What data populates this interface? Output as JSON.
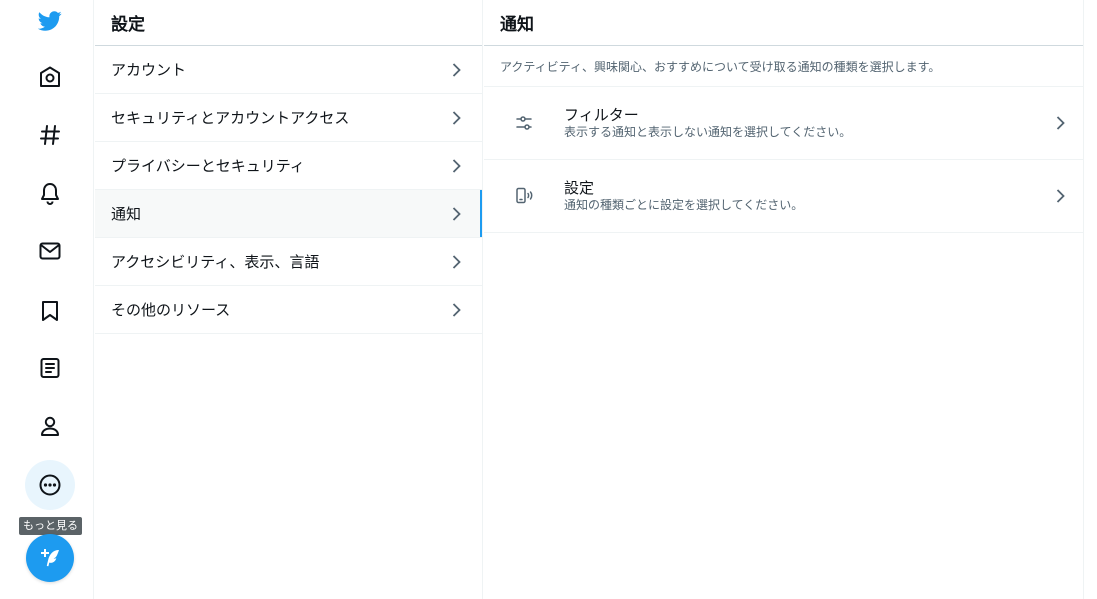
{
  "nav": {
    "items": [
      {
        "icon": "bird-logo-icon"
      },
      {
        "icon": "home-icon"
      },
      {
        "icon": "hashtag-icon"
      },
      {
        "icon": "bell-icon"
      },
      {
        "icon": "envelope-icon"
      },
      {
        "icon": "bookmark-icon"
      },
      {
        "icon": "list-icon"
      },
      {
        "icon": "profile-icon"
      },
      {
        "icon": "more-icon"
      }
    ],
    "more_tooltip": "もっと見る",
    "compose_icon": "compose-tweet-icon",
    "brand_color": "#1d9bf0"
  },
  "settings": {
    "title": "設定",
    "items": [
      {
        "label": "アカウント"
      },
      {
        "label": "セキュリティとアカウントアクセス"
      },
      {
        "label": "プライバシーとセキュリティ"
      },
      {
        "label": "通知",
        "active": true
      },
      {
        "label": "アクセシビリティ、表示、言語"
      },
      {
        "label": "その他のリソース"
      }
    ]
  },
  "notifications": {
    "title": "通知",
    "description": "アクティビティ、興味関心、おすすめについて受け取る通知の種類を選択します。",
    "items": [
      {
        "icon": "filter-sliders-icon",
        "title": "フィルター",
        "subtitle": "表示する通知と表示しない通知を選択してください。"
      },
      {
        "icon": "phone-vibrate-icon",
        "title": "設定",
        "subtitle": "通知の種類ごとに設定を選択してください。"
      }
    ]
  }
}
